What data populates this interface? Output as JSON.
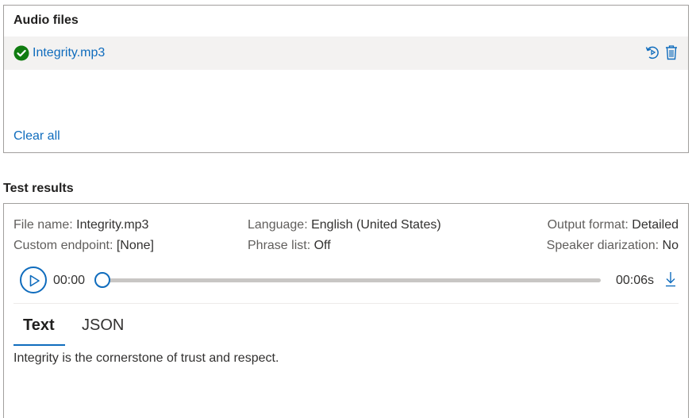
{
  "audio_files": {
    "title": "Audio files",
    "files": [
      {
        "name": "Integrity.mp3",
        "status": "success"
      }
    ],
    "clear_all": "Clear all"
  },
  "test_results": {
    "title": "Test results",
    "meta": {
      "file_name_label": "File name:",
      "file_name_value": "Integrity.mp3",
      "custom_endpoint_label": "Custom endpoint:",
      "custom_endpoint_value": "[None]",
      "language_label": "Language:",
      "language_value": "English (United States)",
      "phrase_list_label": "Phrase list:",
      "phrase_list_value": "Off",
      "output_format_label": "Output format:",
      "output_format_value": "Detailed",
      "speaker_diarization_label": "Speaker diarization:",
      "speaker_diarization_value": "No"
    },
    "player": {
      "current_time": "00:00",
      "duration": "00:06s",
      "progress": 0
    },
    "tabs": [
      {
        "label": "Text",
        "active": true
      },
      {
        "label": "JSON",
        "active": false
      }
    ],
    "transcript": "Integrity is the cornerstone of trust and respect."
  },
  "colors": {
    "accent": "#0f6cbd",
    "success": "#107c10",
    "row_highlight": "#f3f2f1",
    "border": "#a19f9d"
  },
  "icons": {
    "status": "check-circle-icon",
    "retry": "retry-icon",
    "delete": "trash-icon",
    "play": "play-icon",
    "download": "download-icon"
  }
}
